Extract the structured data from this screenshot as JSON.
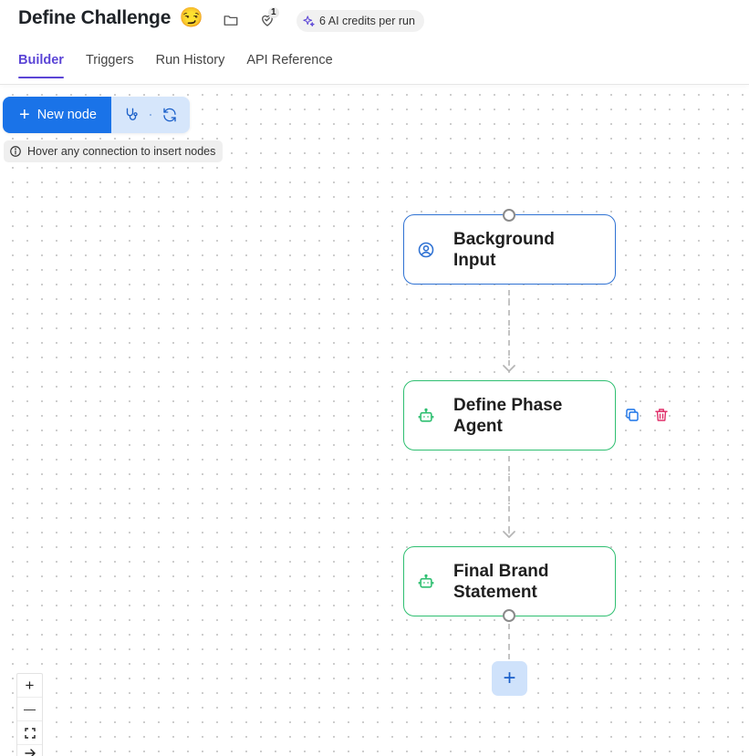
{
  "header": {
    "title": "Define Challenge",
    "title_emoji": "😏",
    "notification_count": "1",
    "credits_label": "6 AI credits per run"
  },
  "tabs": [
    {
      "label": "Builder",
      "active": true
    },
    {
      "label": "Triggers",
      "active": false
    },
    {
      "label": "Run History",
      "active": false
    },
    {
      "label": "API Reference",
      "active": false
    }
  ],
  "toolbar": {
    "new_node_label": "New node"
  },
  "hint": {
    "text": "Hover any connection to insert nodes"
  },
  "nodes": [
    {
      "label": "Background Input",
      "kind": "input",
      "icon": "user-circle-icon"
    },
    {
      "label": "Define Phase Agent",
      "kind": "agent",
      "icon": "robot-icon"
    },
    {
      "label": "Final Brand Statement",
      "kind": "agent",
      "icon": "robot-icon"
    }
  ],
  "node_actions": [
    "copy-icon",
    "trash-icon"
  ],
  "zoom_controls": [
    "+",
    "—",
    "fit-view-icon",
    "arrow-icon"
  ],
  "colors": {
    "accent": "#5b45d6",
    "primary_button": "#1a73e8",
    "input_node_border": "#2f72d3",
    "agent_node_border": "#2fbf71",
    "delete": "#e0306a"
  }
}
